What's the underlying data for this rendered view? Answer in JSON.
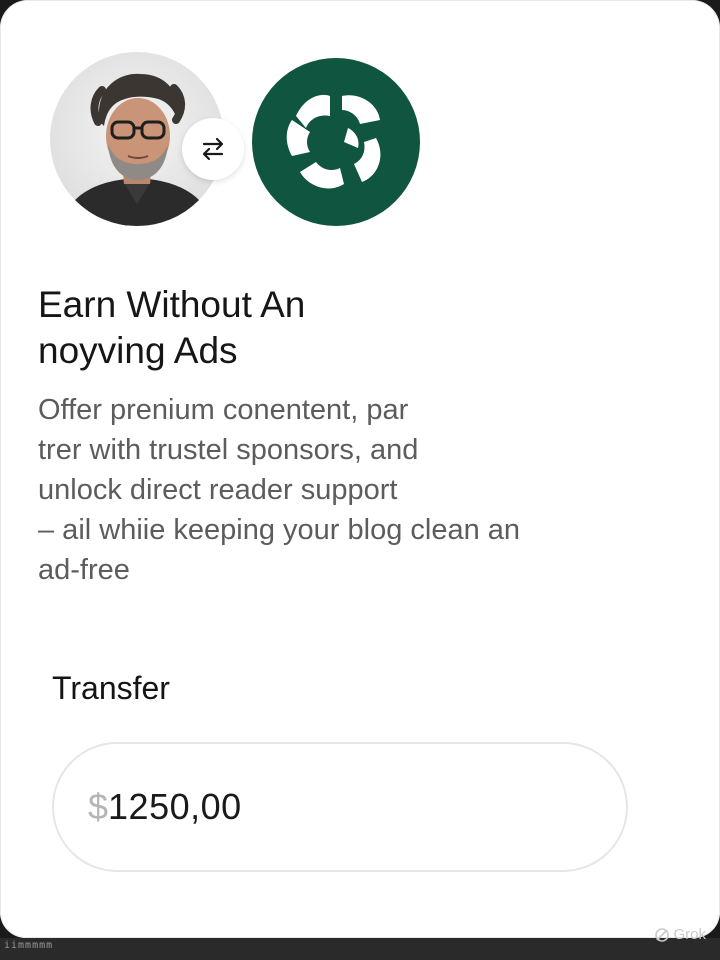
{
  "hero": {
    "swap_icon": "swap-arrows-icon",
    "brand_logo": "leaf-ring-logo",
    "brand_color": "#0f5540"
  },
  "headline": "Earn Without An\nnoyving Ads",
  "description": "Offer prenium conentent, par\ntrer with trustel sponsors, and\nunlock direct reader support\n– ail whiie keeping your blog clean an\nad-free",
  "transfer": {
    "label": "Transfer",
    "currency_symbol": "$",
    "amount": "1250,00"
  },
  "bottom_strip": {
    "text": "iimmmmm"
  },
  "watermark": {
    "icon": "grok-logo-icon",
    "text": "Grok"
  }
}
